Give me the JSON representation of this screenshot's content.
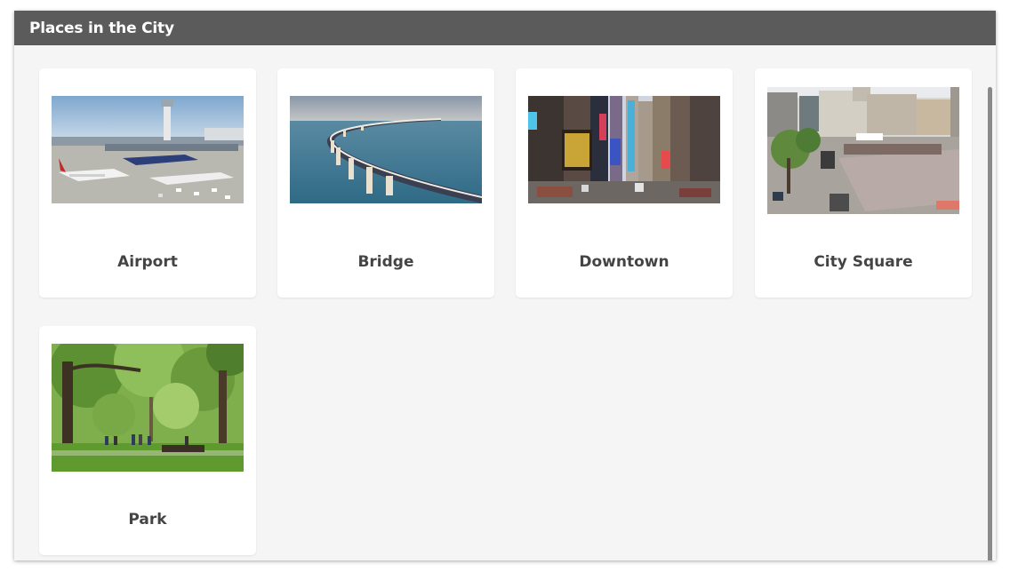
{
  "window": {
    "title": "Places in the City"
  },
  "places": [
    {
      "label": "Airport"
    },
    {
      "label": "Bridge"
    },
    {
      "label": "Downtown"
    },
    {
      "label": "City Square"
    },
    {
      "label": "Park"
    }
  ],
  "colors": {
    "titlebar": "#5b5b5b",
    "background": "#f5f5f5",
    "card": "#ffffff",
    "label_text": "#444444",
    "scrollbar": "#8a8a8a"
  }
}
